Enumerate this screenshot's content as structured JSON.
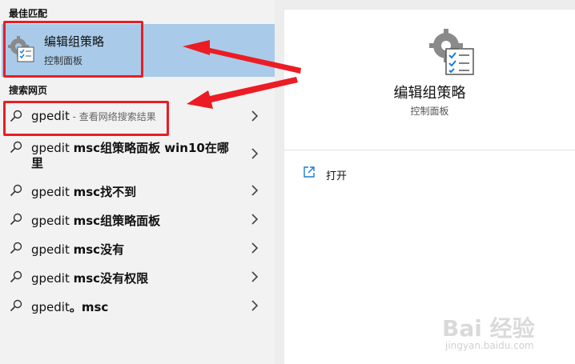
{
  "sections": {
    "best_match": "最佳匹配",
    "web_search": "搜索网页"
  },
  "best_match": {
    "title": "编辑组策略",
    "subtitle": "控制面板",
    "icon": "group-policy-icon"
  },
  "results": [
    {
      "prefix": "gpedit",
      "bold": "",
      "hint": " - 查看网络搜索结果"
    },
    {
      "prefix": "gpedit ",
      "bold": "msc组策略面板 win10在哪",
      "line2": "里"
    },
    {
      "prefix": "gpedit ",
      "bold": "msc找不到"
    },
    {
      "prefix": "gpedit ",
      "bold": "msc组策略面板"
    },
    {
      "prefix": "gpedit ",
      "bold": "msc没有"
    },
    {
      "prefix": "gpedit ",
      "bold": "msc没有权限"
    },
    {
      "prefix": "gpedit",
      "bold": "。msc"
    }
  ],
  "detail": {
    "title": "编辑组策略",
    "subtitle": "控制面板",
    "open_label": "打开",
    "open_icon": "open-external-icon"
  },
  "watermark": {
    "logo": "Bai 经验",
    "url": "jingyan.baidu.com"
  },
  "colors": {
    "selected_bg": "#a9cbe9",
    "annotation_red": "#ec1c24",
    "panel_left": "#f2f2f2",
    "panel_right": "#ffffff"
  }
}
